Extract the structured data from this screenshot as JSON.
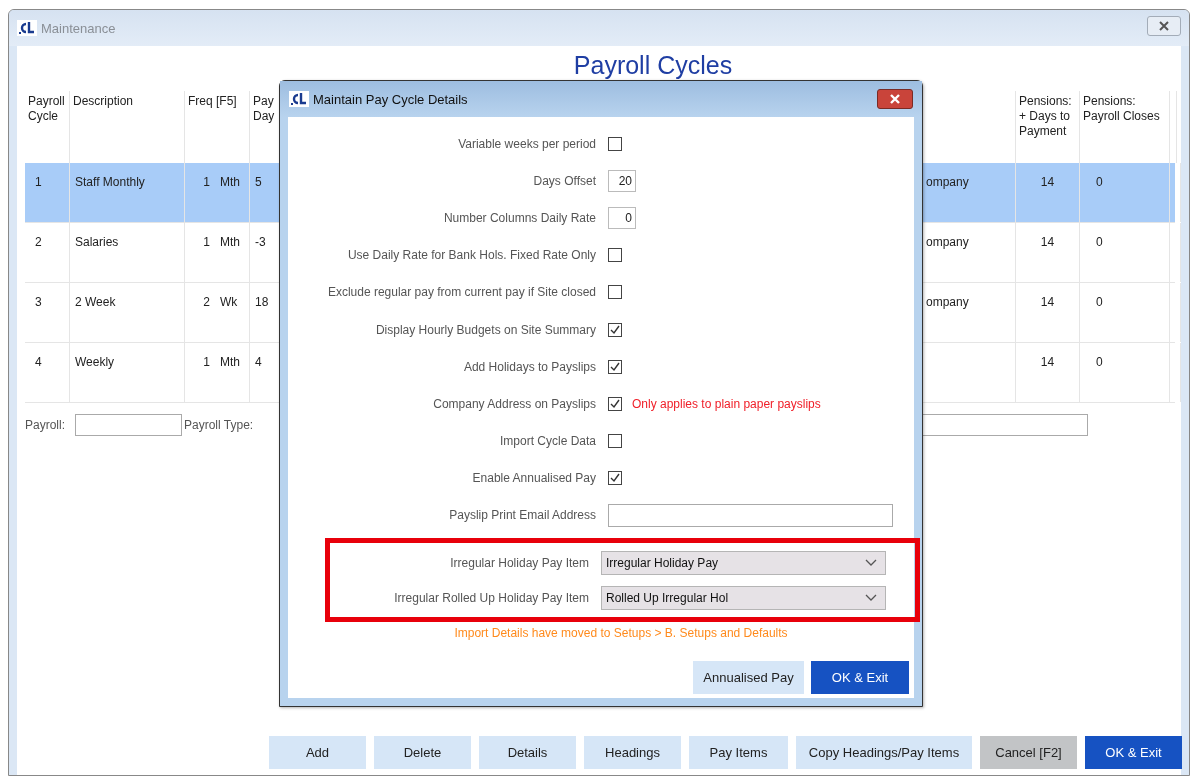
{
  "window": {
    "title": "Maintenance",
    "heading": "Payroll Cycles"
  },
  "table": {
    "columns": [
      "Payroll Cycle",
      "Description",
      "Freq [F5]",
      "Pay Day",
      "Pensions: + Days to Payment",
      "Pensions: Payroll Closes"
    ],
    "rows": [
      {
        "cycle": "1",
        "description": "Staff   Monthly",
        "freq": "1",
        "unit": "Mth",
        "pay_day": "5",
        "column_5": "ompany",
        "days_to_payment": "14",
        "payroll_closes": "0",
        "selected": true
      },
      {
        "cycle": "2",
        "description": "Salaries",
        "freq": "1",
        "unit": "Mth",
        "pay_day": "-3",
        "column_5": "ompany",
        "days_to_payment": "14",
        "payroll_closes": "0",
        "selected": false
      },
      {
        "cycle": "3",
        "description": "2 Week",
        "freq": "2",
        "unit": "Wk",
        "pay_day": "18",
        "column_5": "ompany",
        "days_to_payment": "14",
        "payroll_closes": "0",
        "selected": false
      },
      {
        "cycle": "4",
        "description": "Weekly",
        "freq": "1",
        "unit": "Mth",
        "pay_day": "4",
        "days_to_payment": "14",
        "payroll_closes": "0",
        "selected": false
      }
    ]
  },
  "filters": {
    "payroll_label": "Payroll:",
    "payroll_type_label": "Payroll Type:"
  },
  "dialog": {
    "title": "Maintain Pay Cycle Details",
    "fields": [
      {
        "kind": "checkbox",
        "label": "Variable weeks per period",
        "checked": false
      },
      {
        "kind": "number",
        "label": "Days Offset",
        "value": "20"
      },
      {
        "kind": "number",
        "label": "Number Columns Daily Rate",
        "value": "0"
      },
      {
        "kind": "checkbox",
        "label": "Use Daily Rate for Bank Hols. Fixed Rate Only",
        "checked": false
      },
      {
        "kind": "checkbox",
        "label": "Exclude regular pay from current pay if Site closed",
        "checked": false
      },
      {
        "kind": "checkbox",
        "label": "Display Hourly Budgets on Site Summary",
        "checked": true
      },
      {
        "kind": "checkbox",
        "label": "Add Holidays to Payslips",
        "checked": true
      },
      {
        "kind": "checkbox",
        "label": "Company Address on Payslips",
        "checked": true,
        "note": "Only applies to plain paper payslips"
      },
      {
        "kind": "checkbox",
        "label": "Import Cycle Data",
        "checked": false
      },
      {
        "kind": "checkbox",
        "label": "Enable Annualised Pay",
        "checked": true
      },
      {
        "kind": "text",
        "label": "Payslip Print Email Address"
      }
    ],
    "highlighted_fields": [
      {
        "kind": "select",
        "label": "Irregular Holiday Pay Item",
        "value": "Irregular Holiday Pay"
      },
      {
        "kind": "select",
        "label": "Irregular Rolled Up Holiday Pay Item",
        "value": "Rolled Up Irregular Hol"
      }
    ],
    "notice": "Import Details have moved to Setups > B. Setups and Defaults",
    "buttons": [
      {
        "label": "Annualised Pay",
        "kind": "normal"
      },
      {
        "label": "OK & Exit",
        "kind": "primary"
      }
    ]
  },
  "buttons": [
    {
      "label": "Add",
      "kind": "normal"
    },
    {
      "label": "Delete",
      "kind": "normal"
    },
    {
      "label": "Details",
      "kind": "normal"
    },
    {
      "label": "Headings",
      "kind": "normal"
    },
    {
      "label": "Pay Items",
      "kind": "normal"
    },
    {
      "label": "Copy Headings/Pay Items",
      "kind": "normal"
    },
    {
      "label": "Cancel [F2]",
      "kind": "cancel"
    },
    {
      "label": "OK & Exit",
      "kind": "primary"
    }
  ]
}
